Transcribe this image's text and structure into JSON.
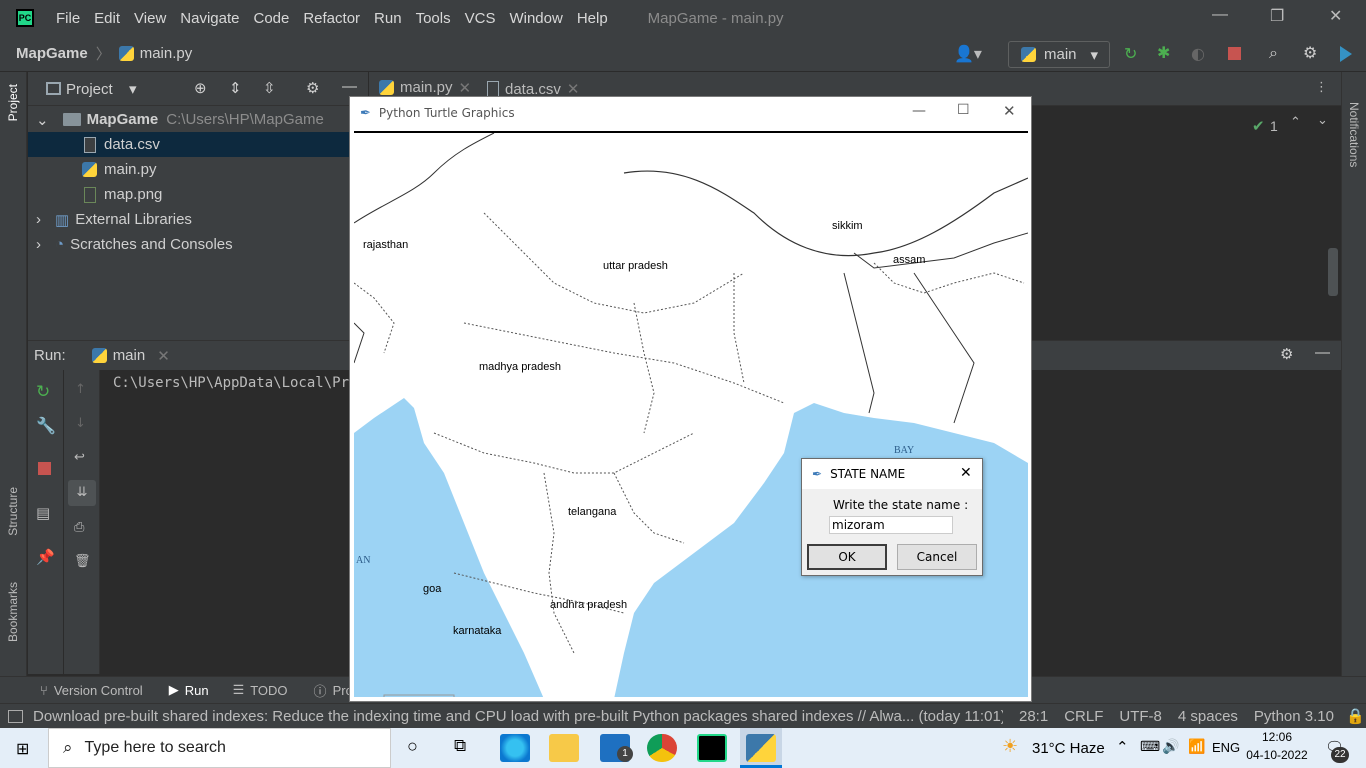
{
  "menubar": {
    "items": [
      "File",
      "Edit",
      "View",
      "Navigate",
      "Code",
      "Refactor",
      "Run",
      "Tools",
      "VCS",
      "Window",
      "Help"
    ],
    "window_title": "MapGame - main.py",
    "logo_text": "PC"
  },
  "navbar": {
    "project": "MapGame",
    "file": "main.py",
    "branch": "main"
  },
  "project_panel": {
    "title": "Project",
    "root": {
      "name": "MapGame",
      "path": "C:\\Users\\HP\\MapGame"
    },
    "files": [
      "data.csv",
      "main.py",
      "map.png"
    ],
    "external_libraries": "External Libraries",
    "scratches": "Scratches and Consoles"
  },
  "editor": {
    "tabs": [
      "main.py",
      "data.csv"
    ],
    "inspections_count": "1"
  },
  "run_panel": {
    "label": "Run:",
    "config": "main",
    "console_line": "C:\\Users\\HP\\AppData\\Local\\Prog"
  },
  "left_strip": {
    "project": "Project",
    "structure": "Structure",
    "bookmarks": "Bookmarks"
  },
  "right_strip": {
    "notifications": "Notifications"
  },
  "bottom_tabs": [
    "Version Control",
    "Run",
    "TODO",
    "Pro"
  ],
  "status_bar": {
    "message": "Download pre-built shared indexes: Reduce the indexing time and CPU load with pre-built Python packages shared indexes // Alwa... (today 11:01)",
    "position": "28:1",
    "line_sep": "CRLF",
    "encoding": "UTF-8",
    "indent": "4 spaces",
    "interpreter": "Python 3.10"
  },
  "turtle_window": {
    "title": "Python Turtle Graphics",
    "states": [
      "rajasthan",
      "uttar pradesh",
      "sikkim",
      "assam",
      "madhya pradesh",
      "telangana",
      "goa",
      "andhra pradesh",
      "karnataka"
    ],
    "sea_labels": [
      "BAY",
      "AN"
    ]
  },
  "dialog": {
    "title": "STATE NAME",
    "prompt": "Write the state name :",
    "value": "mizoram",
    "ok": "OK",
    "cancel": "Cancel"
  },
  "taskbar": {
    "search_placeholder": "Type here to search",
    "mail_badge": "1",
    "weather": "31°C  Haze",
    "lang": "ENG",
    "time": "12:06",
    "date": "04-10-2022",
    "notif_count": "22"
  }
}
